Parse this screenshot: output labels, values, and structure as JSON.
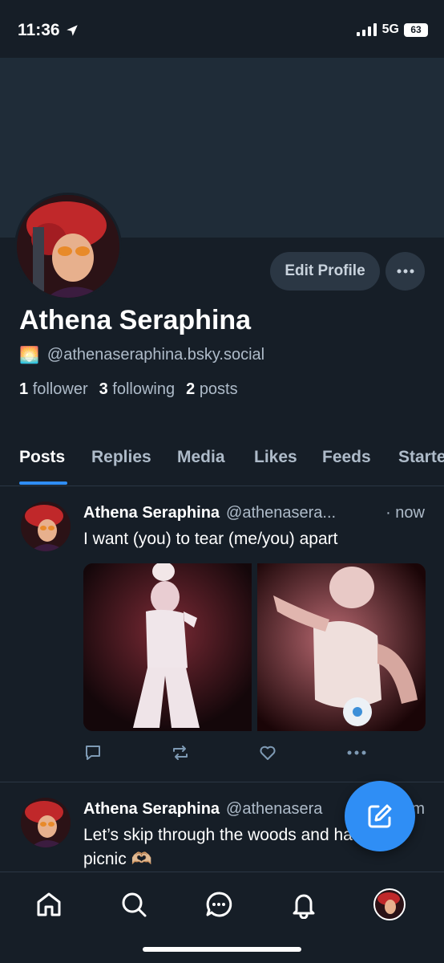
{
  "status": {
    "time": "11:36",
    "network": "5G",
    "battery": "63"
  },
  "profile": {
    "display_name": "Athena Seraphina",
    "handle_emoji": "🌅",
    "handle": "@athenaseraphina.bsky.social",
    "followers_count": "1",
    "followers_label": "follower",
    "following_count": "3",
    "following_label": "following",
    "posts_count": "2",
    "posts_label": "posts",
    "edit_label": "Edit Profile"
  },
  "tabs": [
    {
      "label": "Posts"
    },
    {
      "label": "Replies"
    },
    {
      "label": "Media"
    },
    {
      "label": "Likes"
    },
    {
      "label": "Feeds"
    },
    {
      "label": "Starte"
    }
  ],
  "posts": [
    {
      "name": "Athena Seraphina",
      "handle": "@athenasera...",
      "time": "· now",
      "text": "I want (you) to tear (me/you) apart"
    },
    {
      "name": "Athena Seraphina",
      "handle": "@athenasera",
      "time": "m",
      "text": "Let’s skip through the woods and have a picnic 🫶🏼"
    }
  ],
  "colors": {
    "background": "#161e27",
    "banner": "#1f2c38",
    "accent": "#2f8ef5",
    "button": "#2b3744"
  },
  "icons": {
    "location": "location-arrow-icon",
    "signal": "signal-bars-icon",
    "more": "ellipsis-icon",
    "reply": "comment-icon",
    "repost": "repost-icon",
    "like": "heart-icon",
    "compose": "compose-icon",
    "home": "home-icon",
    "search": "search-icon",
    "chat": "chat-icon",
    "notifications": "bell-icon"
  }
}
